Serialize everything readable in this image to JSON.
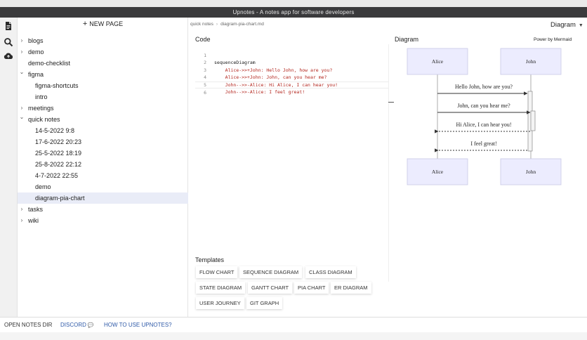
{
  "window": {
    "title": "Upnotes - A notes app for software developers"
  },
  "rail": {
    "icons": [
      "document-icon",
      "search-icon",
      "cloud-upload-icon"
    ]
  },
  "sidebar": {
    "new_page_label": "NEW PAGE",
    "items": [
      {
        "label": "blogs",
        "chevron": "›"
      },
      {
        "label": "demo",
        "chevron": "›"
      },
      {
        "label": "demo-checklist",
        "chevron": ""
      },
      {
        "label": "figma",
        "chevron": "⌄"
      },
      {
        "label": "figma-shortcuts",
        "chevron": ""
      },
      {
        "label": "intro",
        "chevron": ""
      },
      {
        "label": "meetings",
        "chevron": "›"
      },
      {
        "label": "quick notes",
        "chevron": "⌄"
      },
      {
        "label": "14-5-2022 9:8",
        "chevron": ""
      },
      {
        "label": "17-6-2022 20:23",
        "chevron": ""
      },
      {
        "label": "25-5-2022 18:19",
        "chevron": ""
      },
      {
        "label": "25-8-2022 22:12",
        "chevron": ""
      },
      {
        "label": "4-7-2022 22:55",
        "chevron": ""
      },
      {
        "label": "demo",
        "chevron": ""
      },
      {
        "label": "diagram-pia-chart",
        "chevron": ""
      },
      {
        "label": "tasks",
        "chevron": "›"
      },
      {
        "label": "wiki",
        "chevron": "›"
      }
    ]
  },
  "breadcrumb": {
    "parent": "quick notes",
    "separator": "›",
    "current": "diagram-pia-chart.md"
  },
  "code": {
    "title": "Code",
    "lines": [
      {
        "num": "1",
        "text": "sequenceDiagram"
      },
      {
        "num": "2",
        "text": "    Alice->>+John: Hello John, how are you?"
      },
      {
        "num": "3",
        "text": "    Alice->>+John: John, can you hear me?"
      },
      {
        "num": "4",
        "text": "    John-->>-Alice: Hi Alice, I can hear you!"
      },
      {
        "num": "5",
        "text": "    John-->>-Alice: I feel great!"
      },
      {
        "num": "6",
        "text": ""
      }
    ]
  },
  "diagram": {
    "title": "Diagram",
    "mode_select": "Diagram",
    "powered_by": "Power by Mermaid",
    "actors": [
      "Alice",
      "John"
    ],
    "messages": [
      {
        "text": "Hello John, how are you?",
        "kind": "solid"
      },
      {
        "text": "John, can you hear me?",
        "kind": "solid"
      },
      {
        "text": "Hi Alice, I can hear you!",
        "kind": "dotted"
      },
      {
        "text": "I feel great!",
        "kind": "dotted"
      }
    ],
    "colors": {
      "actor_fill": "#ececfe",
      "actor_stroke": "#c8c8e6",
      "line": "#333333"
    }
  },
  "templates": {
    "title": "Templates",
    "buttons": [
      "FLOW CHART",
      "SEQUENCE DIAGRAM",
      "CLASS DIAGRAM",
      "STATE DIAGRAM",
      "GANTT CHART",
      "PIA CHART",
      "ER DIAGRAM",
      "USER JOURNEY",
      "GIT GRAPH"
    ]
  },
  "footer": {
    "open_notes_dir": "OPEN NOTES DIR",
    "discord": "DISCORD",
    "how_to": "HOW TO USE UPNOTES?",
    "link_color": "#2f5aa8"
  }
}
